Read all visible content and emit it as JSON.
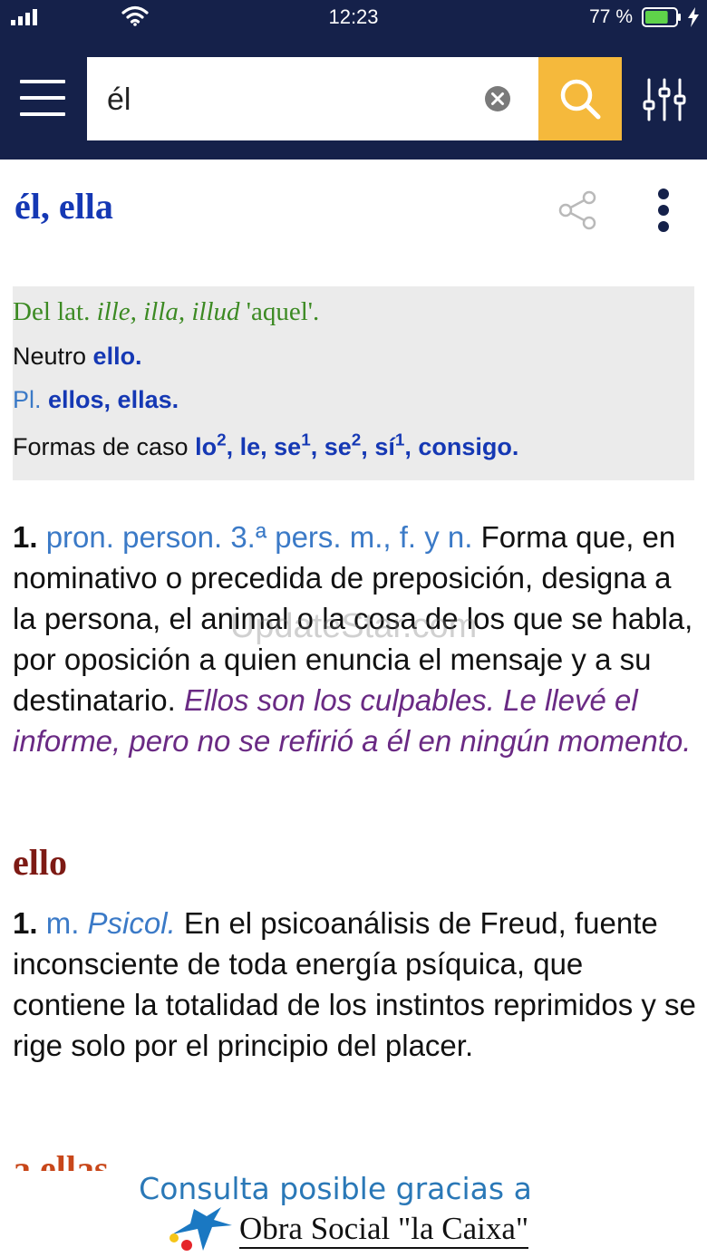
{
  "status_bar": {
    "time": "12:23",
    "battery_percent": "77 %",
    "battery_level": 0.77,
    "signal_icon": "cellular-signal-icon",
    "wifi_icon": "wifi-icon"
  },
  "header": {
    "menu_icon": "hamburger-menu-icon",
    "search_value": "él",
    "clear_icon": "clear-circle-icon",
    "search_icon": "magnifier-icon",
    "filter_icon": "sliders-icon",
    "colors": {
      "bar": "#15214a",
      "search_button": "#f5b93c"
    }
  },
  "entry": {
    "title": "él, ella",
    "share_icon": "share-icon",
    "more_icon": "vertical-dots-icon",
    "etymology": {
      "origin_prefix": "Del lat. ",
      "origin_latin": "ille, illa, illud",
      "origin_suffix": " 'aquel'.",
      "neutro_label": "Neutro ",
      "neutro_value": "ello.",
      "plural_label": "Pl. ",
      "plural_value": "ellos, ellas.",
      "formas_label": "Formas de caso ",
      "formas": [
        {
          "word": "lo",
          "sup": "2",
          "sep": ", "
        },
        {
          "word": "le",
          "sup": "",
          "sep": ", "
        },
        {
          "word": "se",
          "sup": "1",
          "sep": ", "
        },
        {
          "word": "se",
          "sup": "2",
          "sep": ", "
        },
        {
          "word": "sí",
          "sup": "1",
          "sep": ", "
        },
        {
          "word": "consigo.",
          "sup": "",
          "sep": ""
        }
      ]
    },
    "definition_1": {
      "number": "1.",
      "grammar": "pron. person. 3.ª pers. m., f. y n.",
      "text": "Forma que, en nominativo o precedida de preposición, designa a la persona, el animal o la cosa de los que se habla, por oposición a quien enuncia el mensaje y a su destinatario.",
      "example": "Ellos son los culpables. Le llevé el informe, pero no se refirió a él en ningún momento."
    }
  },
  "subentry": {
    "title": "ello",
    "definition_1": {
      "number": "1.",
      "grammar": "m.",
      "field": "Psicol.",
      "text": "En el psicoanálisis de Freud, fuente inconsciente de toda energía psíquica, que contiene la totalidad de los instintos reprimidos y se rige solo por el principio del placer."
    }
  },
  "next_subentry": {
    "title": "a ellas"
  },
  "watermark": "UpdateStar.com",
  "footer": {
    "sponsor_text": "Consulta posible gracias a",
    "logo_text": "Obra Social \"la Caixa\"",
    "logo_icon": "la-caixa-star-logo"
  }
}
